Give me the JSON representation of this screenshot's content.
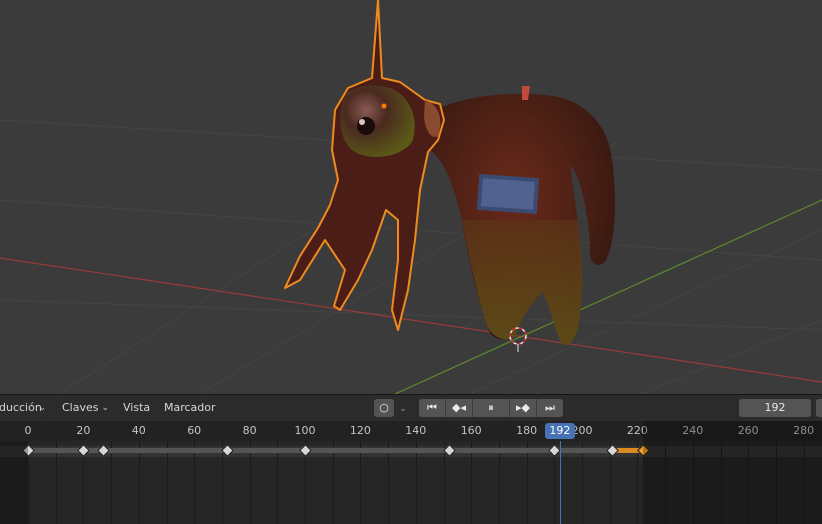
{
  "viewport": {
    "colors": {
      "background": "#3b3b3b",
      "grid": "#444444",
      "x_axis": "#9a3b3b",
      "y_axis": "#5d8a2c",
      "selection_outline": "#f08a1e"
    }
  },
  "timeline": {
    "menus": {
      "playback_label": "ducción",
      "keying_label": "Claves",
      "view_label": "Vista",
      "marker_label": "Marcador"
    },
    "current_frame": "192",
    "frame_start": 0,
    "frame_end": 220,
    "ruler_ticks": [
      "0",
      "20",
      "40",
      "60",
      "80",
      "100",
      "120",
      "140",
      "160",
      "180",
      "200",
      "220",
      "240",
      "260",
      "280"
    ],
    "keyframes": [
      0,
      20,
      27,
      72,
      100,
      152,
      190,
      211,
      222
    ],
    "selected_keyframes": [
      222
    ],
    "hold_selected": [
      211,
      222
    ],
    "colors": {
      "playhead": "#4772b3",
      "keyframe": "#d6d6d6",
      "keyframe_selected": "#f0a030"
    }
  }
}
